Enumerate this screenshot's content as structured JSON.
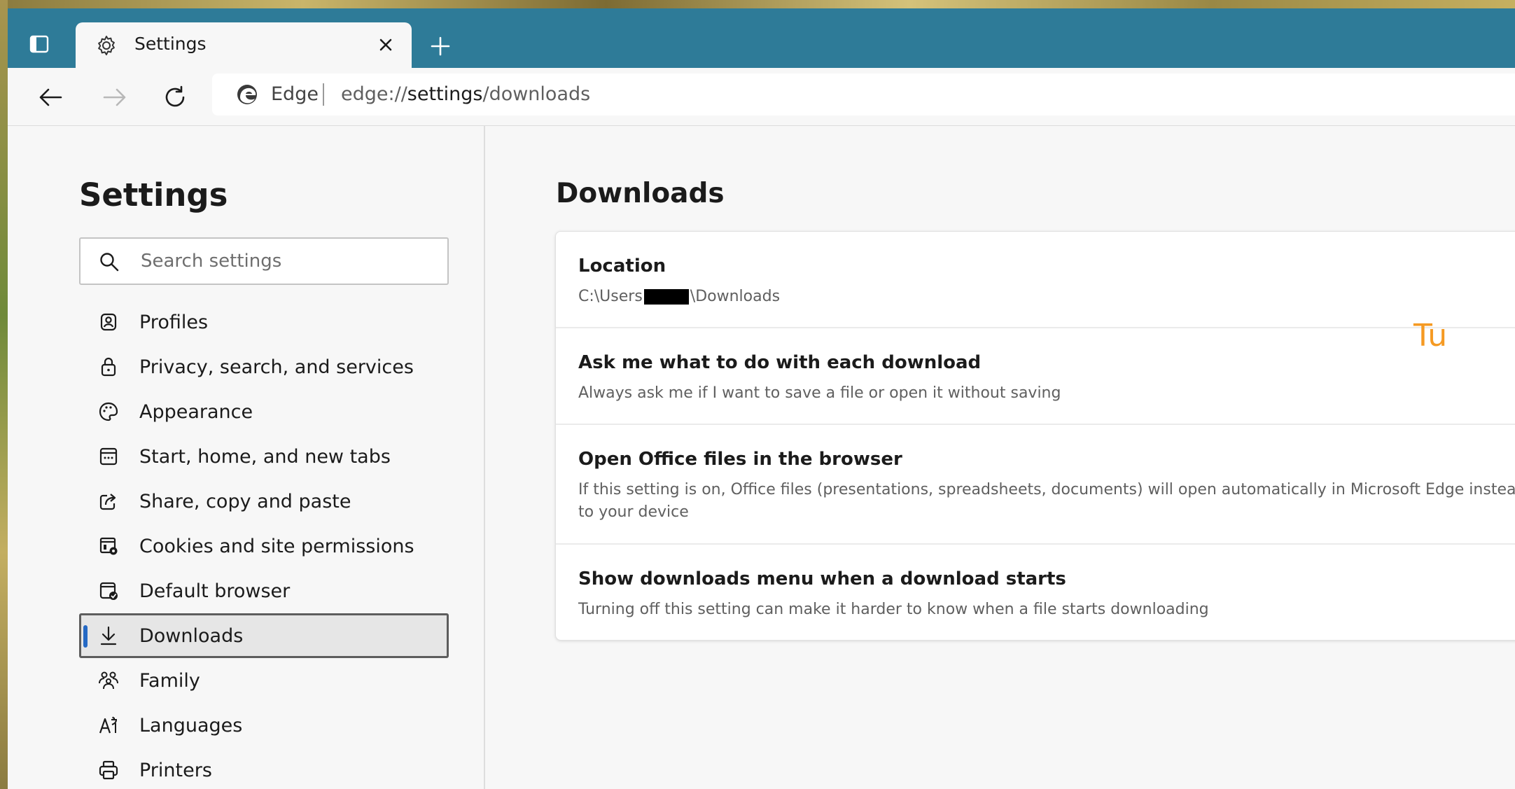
{
  "tab": {
    "title": "Settings"
  },
  "address_bar": {
    "site_label": "Edge",
    "url_scheme": "edge://",
    "url_host": "settings",
    "url_path": "/downloads"
  },
  "sidebar": {
    "title": "Settings",
    "search_placeholder": "Search settings",
    "items": [
      {
        "label": "Profiles",
        "icon": "profile-icon"
      },
      {
        "label": "Privacy, search, and services",
        "icon": "lock-icon"
      },
      {
        "label": "Appearance",
        "icon": "palette-icon"
      },
      {
        "label": "Start, home, and new tabs",
        "icon": "start-page-icon"
      },
      {
        "label": "Share, copy and paste",
        "icon": "share-icon"
      },
      {
        "label": "Cookies and site permissions",
        "icon": "cookie-settings-icon"
      },
      {
        "label": "Default browser",
        "icon": "default-browser-icon"
      },
      {
        "label": "Downloads",
        "icon": "download-icon",
        "active": true
      },
      {
        "label": "Family",
        "icon": "family-icon"
      },
      {
        "label": "Languages",
        "icon": "languages-icon"
      },
      {
        "label": "Printers",
        "icon": "printer-icon"
      }
    ]
  },
  "main": {
    "title": "Downloads",
    "settings": [
      {
        "title": "Location",
        "desc_prefix": "C:\\Users",
        "desc_suffix": "\\Downloads"
      },
      {
        "title": "Ask me what to do with each download",
        "desc": "Always ask me if I want to save a file or open it without saving"
      },
      {
        "title": "Open Office files in the browser",
        "desc_line1": "If this setting is on, Office files (presentations, spreadsheets, documents) will open automatically in Microsoft Edge instead of d",
        "desc_line2": "to your device"
      },
      {
        "title": "Show downloads menu when a download starts",
        "desc": "Turning off this setting can make it harder to know when a file starts downloading"
      }
    ],
    "overlay_text": "Tu"
  },
  "colors": {
    "tabbar": "#2e7b98",
    "active_accent": "#2569c4",
    "overlay": "#f59a23"
  }
}
